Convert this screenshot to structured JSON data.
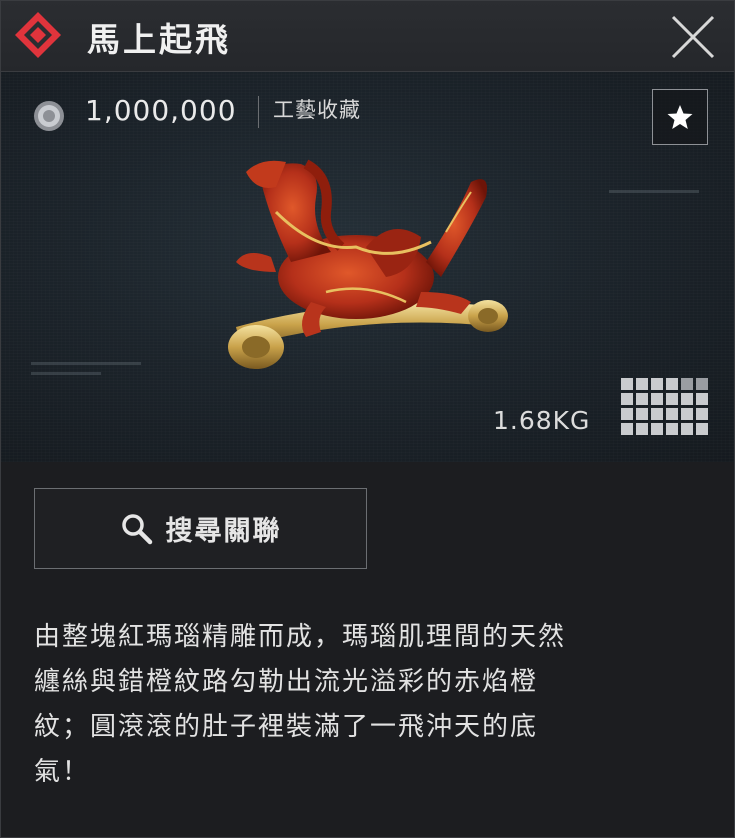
{
  "header": {
    "title": "馬上起飛",
    "rarity_icon": "diamond-icon",
    "close_icon": "close-icon"
  },
  "item": {
    "price": "1,000,000",
    "currency_icon": "coin-icon",
    "category": "工藝收藏",
    "weight": "1.68KG",
    "favorite_icon": "star-icon",
    "size_icon": "inventory-grid-icon"
  },
  "actions": {
    "search_label": "搜尋關聯",
    "search_icon": "search-icon"
  },
  "description": [
    "由整塊紅瑪瑙精雕而成，瑪瑙肌理間的天然",
    "纏絲與錯橙紋路勾勒出流光溢彩的赤焰橙",
    "紋；圓滾滾的肚子裡裝滿了一飛沖天的底",
    "氣！"
  ],
  "colors": {
    "rarity": "#e0343c",
    "accent": "#c23a1c",
    "gold": "#d4b25a"
  }
}
